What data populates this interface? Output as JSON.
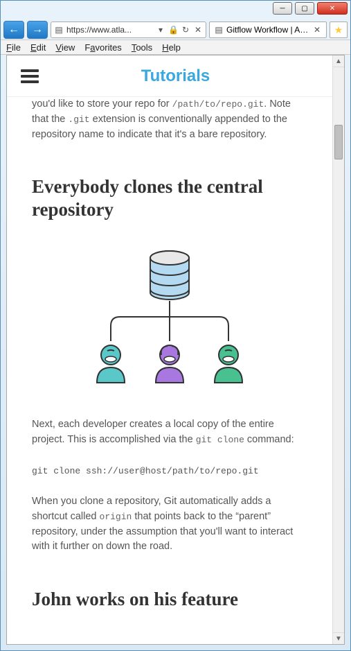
{
  "browser": {
    "url": "https://www.atla...",
    "tab_title": "Gitflow Workflow | Atl...",
    "menu": {
      "file": "File",
      "edit": "Edit",
      "view": "View",
      "favorites": "Favorites",
      "tools": "Tools",
      "help": "Help"
    }
  },
  "header": {
    "title": "Tutorials"
  },
  "content": {
    "intro_part1": "you'd like to store your repo for ",
    "intro_code1": "/path/to/repo.git",
    "intro_part2": ". Note that the ",
    "intro_code2": ".git",
    "intro_part3": " extension is conventionally appended to the repository name to indicate that it's a bare repository.",
    "h2_clone": "Everybody clones the central repository",
    "clone_p1a": "Next, each developer creates a local copy of the entire project. This is accomplished via the ",
    "clone_p1_code": "git clone",
    "clone_p1b": " command:",
    "clone_cmd": "git clone ssh://user@host/path/to/repo.git",
    "clone_p2a": "When you clone a repository, Git automatically adds a shortcut called ",
    "clone_p2_code": "origin",
    "clone_p2b": " that points back to the “parent” repository, under the assumption that you'll want to interact with it further on down the road.",
    "h2_john": "John works on his feature"
  }
}
